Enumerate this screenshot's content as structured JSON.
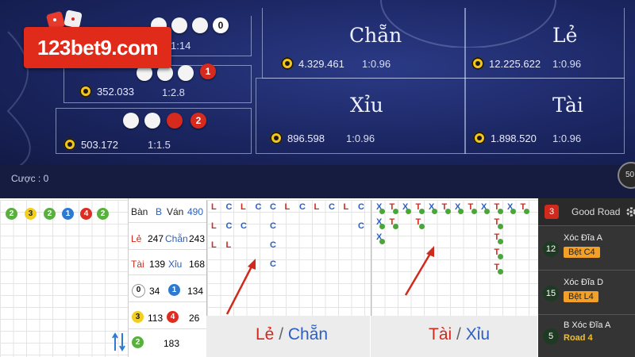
{
  "brand": {
    "logo_text": "123bet9.com"
  },
  "table": {
    "rows": [
      {
        "amount": "",
        "ratio": "1:14"
      },
      {
        "amount": "352.033",
        "ratio": "1:2.8"
      },
      {
        "amount": "503.172",
        "ratio": "1:1.5"
      }
    ],
    "bets": [
      {
        "title": "Chẵn",
        "amount": "4.329.461",
        "ratio": "1:0.96"
      },
      {
        "title": "Lẻ",
        "amount": "12.225.622",
        "ratio": "1:0.96"
      },
      {
        "title": "Xỉu",
        "amount": "896.598",
        "ratio": "1:0.96"
      },
      {
        "title": "Tài",
        "amount": "1.898.520",
        "ratio": "1:0.96"
      }
    ],
    "disc_badges": {
      "row0": "0",
      "row1": "1",
      "row2": "2"
    },
    "corner_badge": "50"
  },
  "cuoc": "Cược : 0",
  "history_balls": [
    "2",
    "3",
    "2",
    "1",
    "4",
    "2"
  ],
  "stats": {
    "row1": {
      "ban": "Bàn",
      "b": "B",
      "van": "Ván",
      "van_value": "490"
    },
    "row2": {
      "le": "Lẻ",
      "le_value": "247",
      "chan": "Chẵn",
      "chan_value": "243"
    },
    "row3": {
      "tai": "Tài",
      "tai_value": "139",
      "xiu": "Xỉu",
      "xiu_value": "168"
    },
    "row4": {
      "a": "0",
      "a_value": "34",
      "b": "1",
      "b_value": "134"
    },
    "row5": {
      "a": "3",
      "a_value": "113",
      "b": "4",
      "b_value": "26"
    },
    "row6": {
      "a": "2",
      "a_value": "183"
    }
  },
  "road_le_chan": {
    "label_a": "Lẻ",
    "sep": "/",
    "label_b": "Chẵn",
    "columns": [
      [
        "L",
        "L",
        "L"
      ],
      [
        "C",
        "C",
        "L"
      ],
      [
        "L",
        "C"
      ],
      [
        "C"
      ],
      [
        "C",
        "C",
        "C",
        "C"
      ],
      [
        "L"
      ],
      [
        "C"
      ],
      [
        "L"
      ],
      [
        "C"
      ],
      [
        "L"
      ],
      [
        "C",
        "C"
      ]
    ]
  },
  "road_tai_xiu": {
    "label_a": "Tài",
    "sep": "/",
    "label_b": "Xỉu",
    "columns": [
      [
        "X",
        "X",
        "X"
      ],
      [
        "T",
        "T"
      ],
      [
        "X"
      ],
      [
        "T",
        "T"
      ],
      [
        "X"
      ],
      [
        "T"
      ],
      [
        "X"
      ],
      [
        "T"
      ],
      [
        "X"
      ],
      [
        "T",
        "T",
        "T",
        "T",
        "T"
      ],
      [
        "X"
      ],
      [
        "T"
      ]
    ]
  },
  "right_panel": {
    "badge": "3",
    "good_road": "Good Road",
    "items": [
      {
        "num": "12",
        "name": "Xóc Đĩa A",
        "tag": "Bệt C4"
      },
      {
        "num": "15",
        "name": "Xóc Đĩa D",
        "tag": "Bệt L4"
      },
      {
        "num": "5",
        "name": "B Xóc Đĩa A",
        "tag": "Road 4"
      }
    ]
  },
  "icons": {
    "swap": "swap-arrows-icon",
    "settings": "gear-icon"
  }
}
